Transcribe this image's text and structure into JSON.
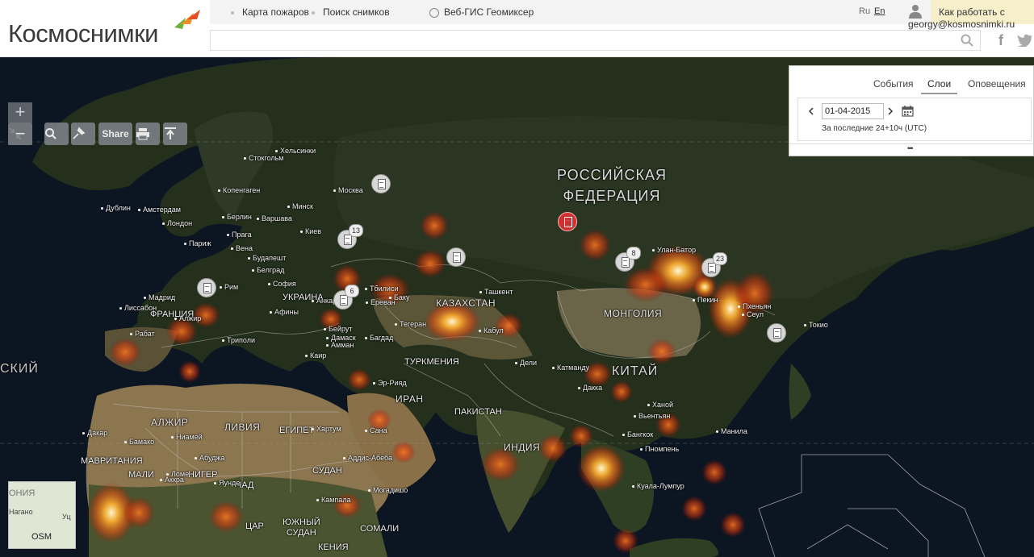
{
  "header": {
    "logo": "Космоснимки",
    "nav": [
      "Карта пожаров",
      "Поиск снимков",
      "Веб-ГИС Геомиксер"
    ],
    "help": "Как работать с картой?",
    "lang_ru": "Ru",
    "lang_en": "En",
    "user": "georgy@kosmosnimki.ru",
    "search_placeholder": ""
  },
  "toolbar": {
    "share_label": "Share",
    "zoom_in": "+",
    "zoom_out": "−"
  },
  "panel": {
    "tabs": [
      "События",
      "Слои",
      "Оповещения"
    ],
    "active_tab": "Слои",
    "date": "01-04-2015",
    "period": "За последние 24+10ч (UTC)",
    "more": "•••"
  },
  "minimap": {
    "label": "OSM",
    "text1": "ОНИЯ",
    "text2": "Нагано",
    "text3": "Уц"
  },
  "markers": [
    {
      "count": "13"
    },
    {
      "count": "6"
    },
    {
      "count": "8"
    },
    {
      "count": "23"
    }
  ],
  "map_labels": {
    "countries": {
      "russia1": "РОССИЙСКАЯ",
      "russia2": "ФЕДЕРАЦИЯ",
      "kazakhstan": "КАЗАХСТАН",
      "mongolia": "МОНГОЛИЯ",
      "china": "КИТАЙ",
      "india": "ИНДИЯ",
      "iran": "ИРАН",
      "pakistan": "ПАКИСТАН",
      "turkmenia": "ТУРКМЕНИЯ",
      "ukraine": "УКРАИНА",
      "france": "ФРАНЦИЯ",
      "algeria": "АЛЖИР",
      "libya": "ЛИВИЯ",
      "egypt": "ЕГИПЕТ",
      "mauritania": "МАВРИТАНИЯ",
      "mali": "МАЛИ",
      "niger": "НИГЕР",
      "chad": "ЧАД",
      "sudan": "СУДАН",
      "south_sudan1": "ЮЖНЫЙ",
      "south_sudan2": "СУДАН",
      "somalia": "СОМАЛИ",
      "car": "ЦАР",
      "kenya": "КЕНИЯ",
      "left_edge": "СКИЙ"
    },
    "cities": [
      "Хельсинки",
      "Стокгольм",
      "Москва",
      "Копенгаген",
      "Дублин",
      "Амстердам",
      "Берлин",
      "Варшава",
      "Минск",
      "Лондон",
      "Прага",
      "Киев",
      "Париж",
      "Вена",
      "Будапешт",
      "Белград",
      "Рим",
      "София",
      "Мадрид",
      "Лиссабон",
      "Алжир",
      "Рабат",
      "Триполи",
      "Анкара",
      "Афины",
      "Тбилиси",
      "Ереван",
      "Баку",
      "Бейрут",
      "Дамаск",
      "Амман",
      "Багдад",
      "Тегеран",
      "Каир",
      "Эр-Рияд",
      "Ташкент",
      "Кабул",
      "Дели",
      "Катманду",
      "Дакка",
      "Улан-Батор",
      "Пекин",
      "Пхеньян",
      "Сеул",
      "Токио",
      "Ханой",
      "Вьентьян",
      "Бангкок",
      "Пномпень",
      "Манила",
      "Куала-Лумпур",
      "Хартум",
      "Сана",
      "Аддис-Абеба",
      "Могадишо",
      "Кампала",
      "Ниамей",
      "Абуджа",
      "Ломе",
      "Аккра",
      "Яунде",
      "Дакар",
      "Бамако"
    ]
  }
}
